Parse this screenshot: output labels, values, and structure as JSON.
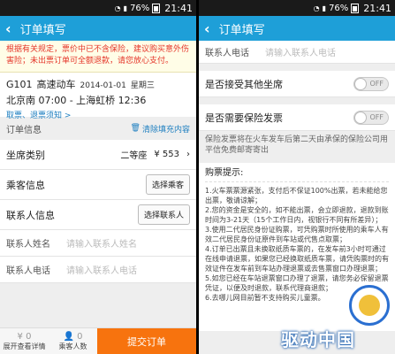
{
  "status": {
    "battery": "76%",
    "time": "21:41"
  },
  "appbar": {
    "back_icon": "‹",
    "title": "订单填写"
  },
  "notice": {
    "text": "根据有关规定，票价中已不含保险，建议购买意外伤害险；未出票订单可全额退款，请您放心支付。"
  },
  "train": {
    "number": "G101",
    "type": "高速动车",
    "date": "2014-01-01",
    "weekday": "星期三",
    "route": "北京南 07:00 - 上海虹桥 12:36",
    "rules_link": "取票、退票须知 >"
  },
  "order_section": {
    "title": "订单信息",
    "clear_label": "清除填充内容"
  },
  "seat": {
    "label": "坐席类别",
    "class": "二等座",
    "price": "¥ 553",
    "chevron": "›"
  },
  "passenger": {
    "label": "乘客信息",
    "button": "选择乘客"
  },
  "contact": {
    "label": "联系人信息",
    "button": "选择联系人"
  },
  "fields": {
    "name_label": "联系人姓名",
    "name_placeholder": "请输入联系人姓名",
    "phone_label": "联系人电话",
    "phone_placeholder": "请输入联系人电话"
  },
  "bottom": {
    "count": "0",
    "detail_label": "展开查看详情",
    "passenger_count_label": "乘客人数",
    "submit": "提交订单"
  },
  "right": {
    "toggle_other_seat": "是否接受其他坐席",
    "toggle_invoice": "是否需要保险发票",
    "toggle_off": "OFF",
    "invoice_desc": "保险发票将在火车发车后第二天由承保的保险公司用平信免费邮寄寄出",
    "tips_title": "购票提示:",
    "tips": [
      "1.火车票票源紧张，支付后不保证100%出票，若未能给您出票，敬请谅解；",
      "2.您的资金是安全的，如不能出票，会立即退款，退款到账时间为3-21天（15个工作日内，视银行不同有所差异）；",
      "3.使用二代居民身份证购票，可凭购票时所使用的乘车人有效二代居民身份证原件到车站或代售点取票；",
      "4.订单已出票且未换取纸质车票的，在发车前3小时可通过在线申请退票，如果您已经换取纸质车票，请凭购票时的有效证件在发车前到车站办理退票或去售票窗口办理退票；",
      "5.如您已经在车站退票窗口办理了退票，请您务必保留退票凭证，以便及时退款，联系代理商退款；",
      "6.去哪儿网目前暂不支持购买儿童票。"
    ],
    "watermark": "驱动中国"
  }
}
